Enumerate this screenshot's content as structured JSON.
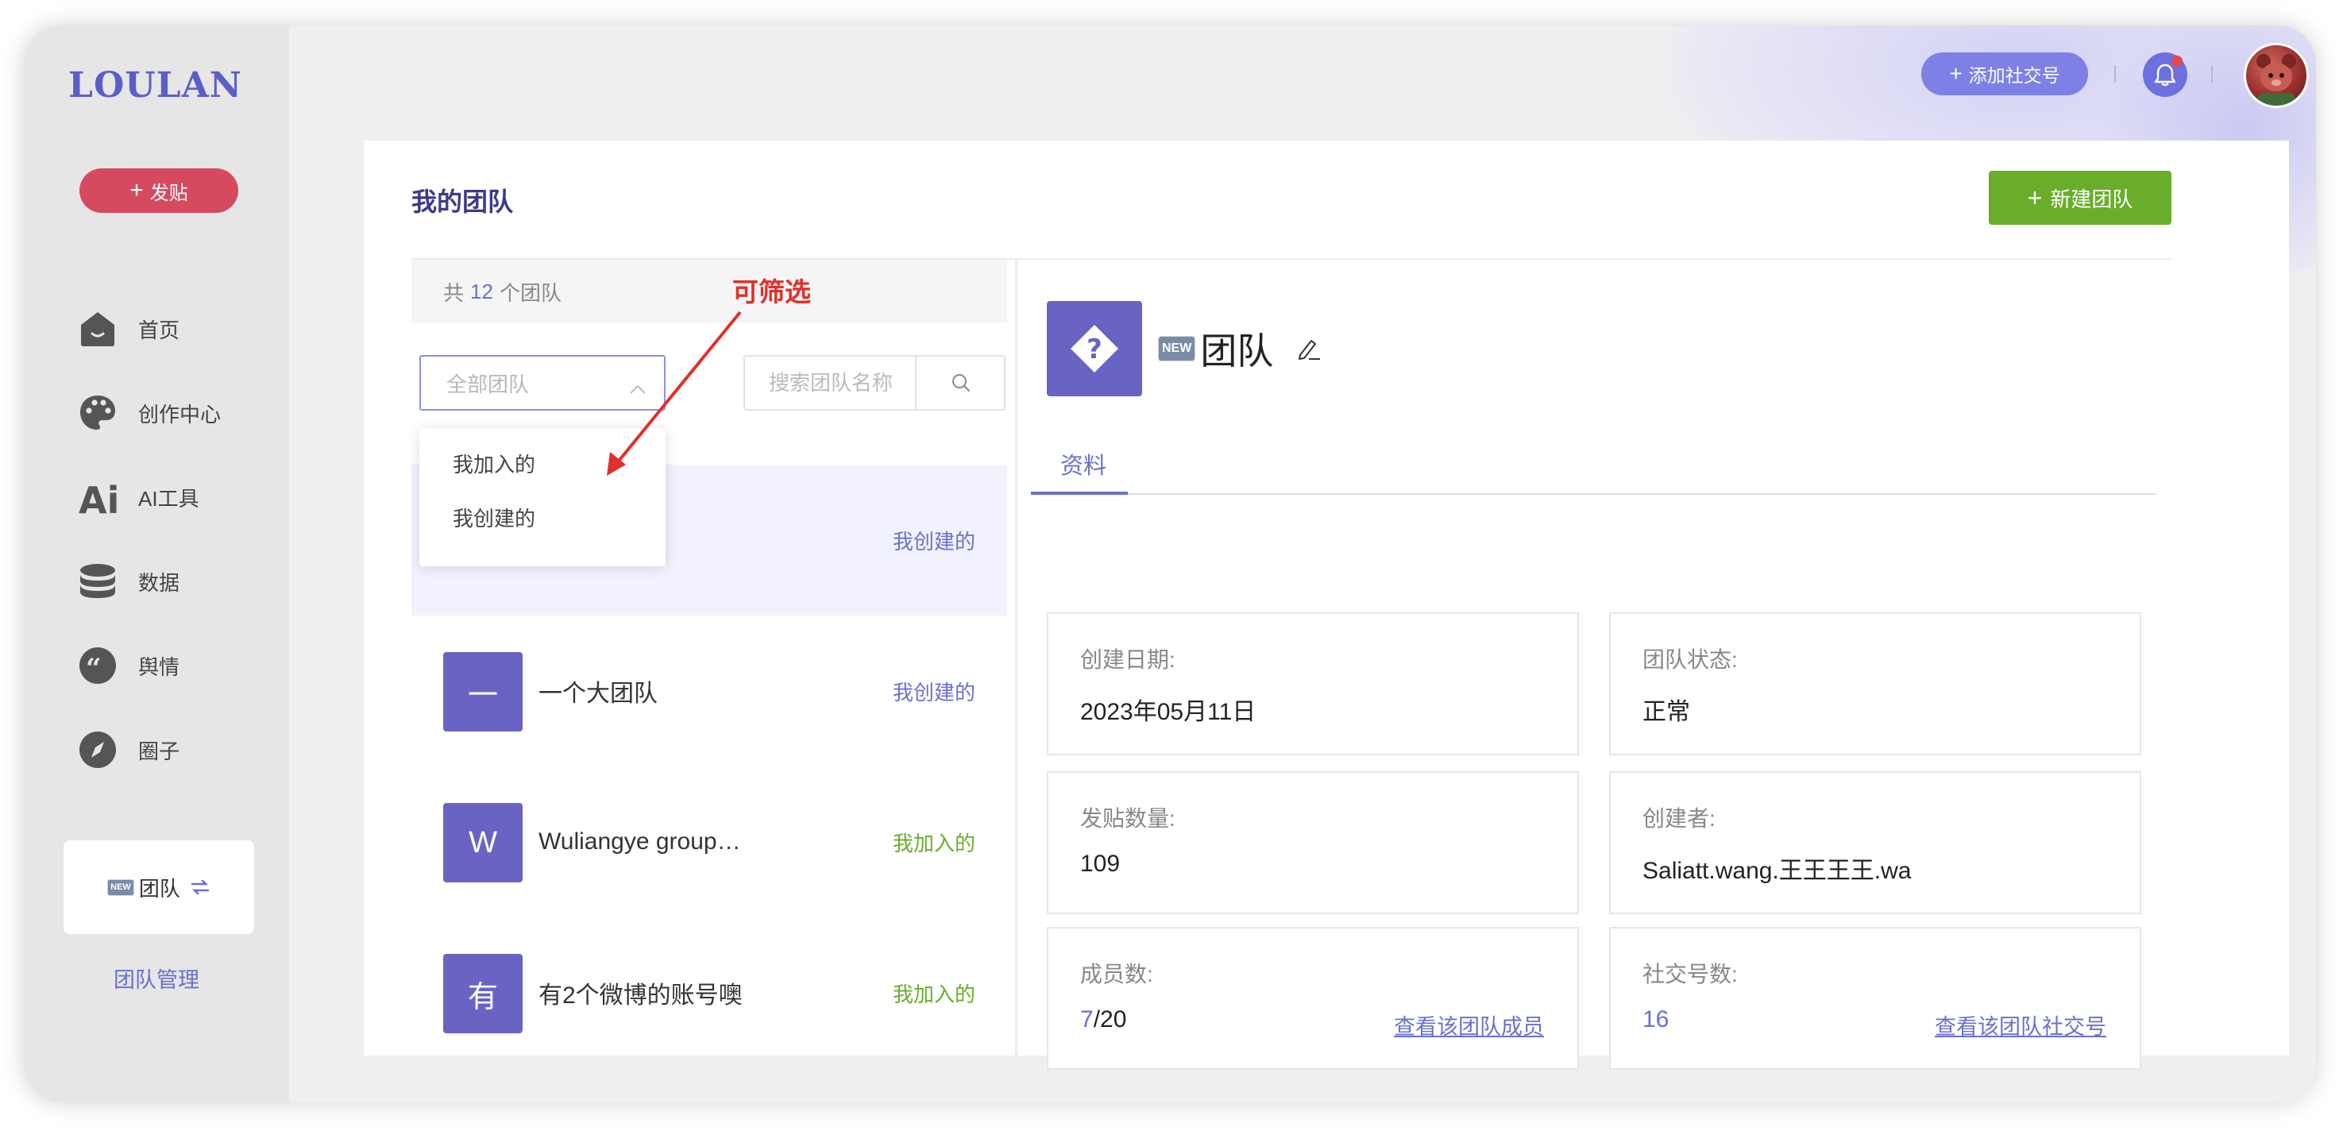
{
  "brand": {
    "logo": "LOULAN"
  },
  "sidebar": {
    "post_label": "发贴",
    "items": [
      {
        "label": "首页",
        "icon": "home-icon"
      },
      {
        "label": "创作中心",
        "icon": "palette-icon"
      },
      {
        "label": "AI工具",
        "icon": "ai-icon"
      },
      {
        "label": "数据",
        "icon": "database-icon"
      },
      {
        "label": "舆情",
        "icon": "quote-icon"
      },
      {
        "label": "圈子",
        "icon": "compass-icon"
      }
    ],
    "team_card": {
      "badge": "NEW",
      "label": "团队"
    },
    "team_mgmt": "团队管理"
  },
  "topbar": {
    "add_account": "添加社交号"
  },
  "page": {
    "title": "我的团队",
    "new_team_button": "新建团队",
    "count_prefix": "共",
    "count": "12",
    "count_suffix": "个团队",
    "filter_placeholder": "全部团队",
    "search_placeholder": "搜索团队名称",
    "filter_options": [
      "我加入的",
      "我创建的"
    ],
    "annotation": "可筛选",
    "teams": [
      {
        "avatar": "",
        "name": "",
        "tag": "我创建的"
      },
      {
        "avatar": "一",
        "name": "一个大团队",
        "tag": "我创建的"
      },
      {
        "avatar": "W",
        "name": "Wuliangye group…",
        "tag": "我加入的"
      },
      {
        "avatar": "有",
        "name": "有2个微博的账号噢",
        "tag": "我加入的"
      }
    ]
  },
  "detail": {
    "badge": "NEW",
    "name": "团队",
    "tab": "资料",
    "created_label": "创建日期:",
    "created_value": "2023年05月11日",
    "status_label": "团队状态:",
    "status_value": "正常",
    "posts_label": "发贴数量:",
    "posts_value": "109",
    "creator_label": "创建者:",
    "creator_value": "Saliatt.wang.王王王王.wa",
    "members_label": "成员数:",
    "members_current": "7",
    "members_total": "/20",
    "members_link": "查看该团队成员",
    "accounts_label": "社交号数:",
    "accounts_value": "16",
    "accounts_link": "查看该团队社交号"
  },
  "colors": {
    "brand": "#5a5fc7",
    "accent": "#6a70cf",
    "post_button": "#d64a5f",
    "new_team_button": "#6aad2a",
    "team_avatar": "#6964c4",
    "annotation": "#e0302a"
  }
}
